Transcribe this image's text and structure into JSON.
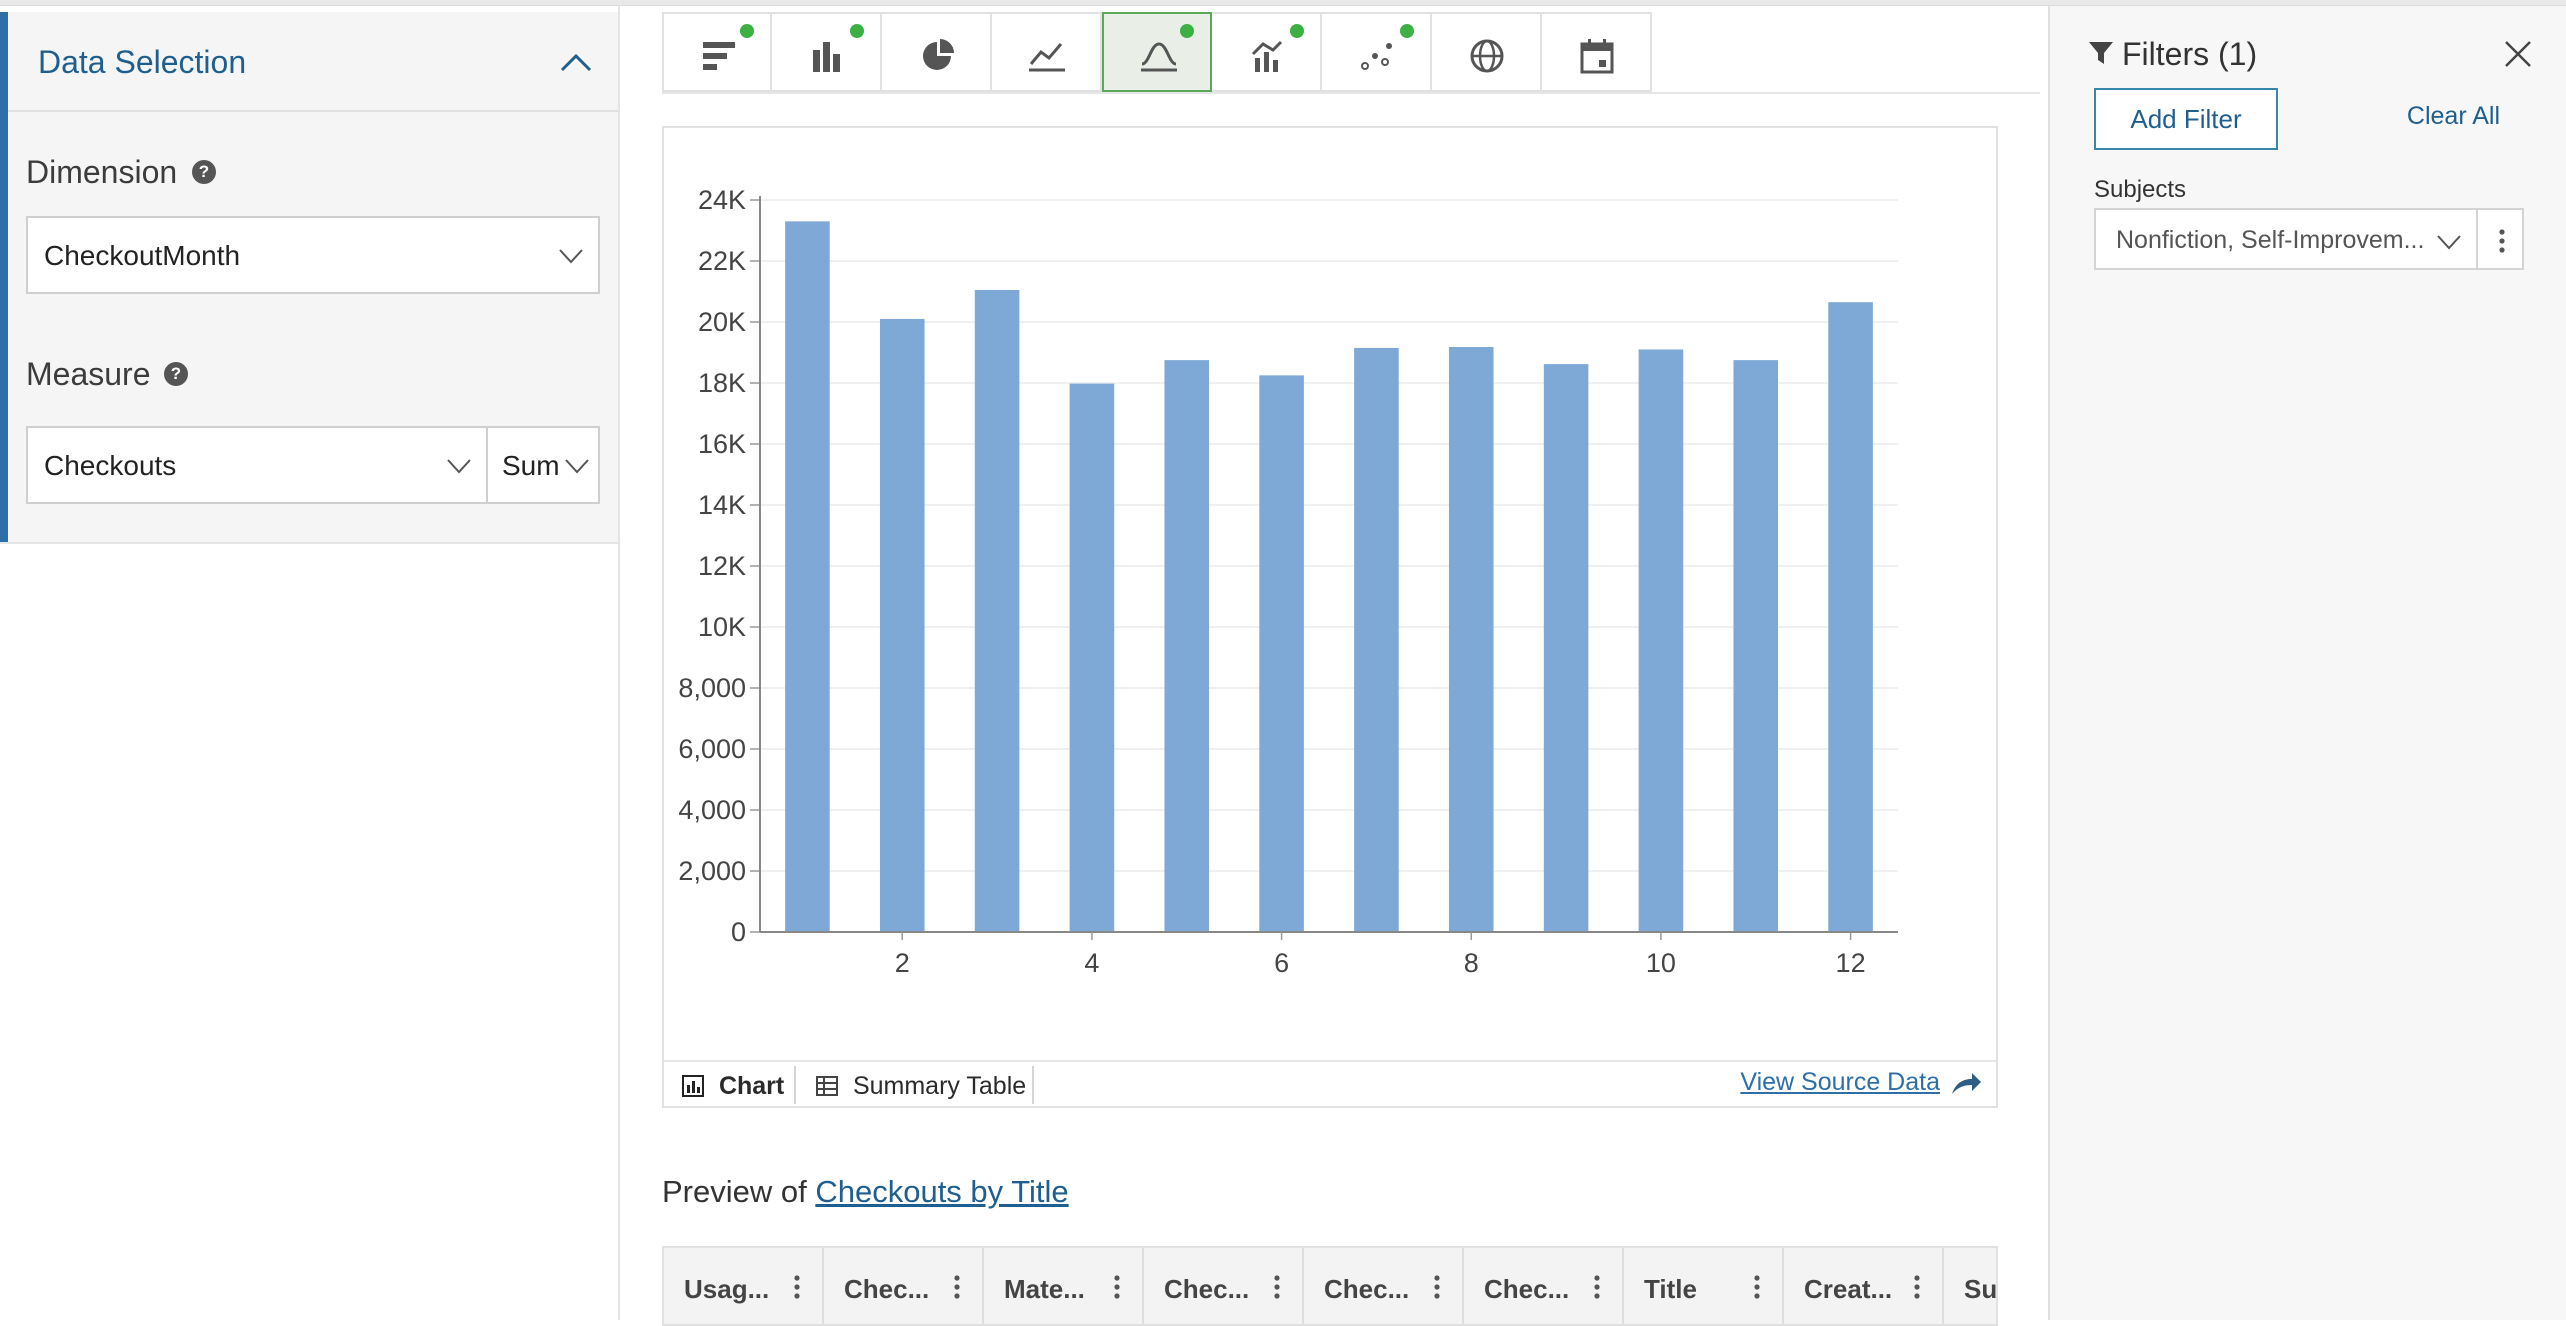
{
  "data_selection": {
    "title": "Data Selection",
    "dimension_label": "Dimension",
    "dimension_value": "CheckoutMonth",
    "measure_label": "Measure",
    "measure_value": "Checkouts",
    "aggregation_value": "Sum"
  },
  "toolbar": {
    "buttons": [
      {
        "icon": "horizontal-bar-chart-icon",
        "has_dot": true,
        "active": false
      },
      {
        "icon": "column-chart-icon",
        "has_dot": true,
        "active": false
      },
      {
        "icon": "pie-chart-icon",
        "has_dot": false,
        "active": false
      },
      {
        "icon": "line-chart-icon",
        "has_dot": false,
        "active": false
      },
      {
        "icon": "distribution-chart-icon",
        "has_dot": true,
        "active": true
      },
      {
        "icon": "combo-chart-icon",
        "has_dot": true,
        "active": false
      },
      {
        "icon": "scatter-chart-icon",
        "has_dot": true,
        "active": false
      },
      {
        "icon": "globe-map-icon",
        "has_dot": false,
        "active": false
      },
      {
        "icon": "calendar-icon",
        "has_dot": false,
        "active": false
      }
    ],
    "dot_color": "#3cb043",
    "active_bg": "#e9efe7"
  },
  "chart_data": {
    "type": "bar",
    "x": [
      1,
      2,
      3,
      4,
      5,
      6,
      7,
      8,
      9,
      10,
      11,
      12
    ],
    "values": [
      23300,
      20100,
      21050,
      17980,
      18750,
      18250,
      19150,
      19180,
      18620,
      19100,
      18750,
      20650
    ],
    "y_ticks": [
      "0",
      "2,000",
      "4,000",
      "6,000",
      "8,000",
      "10K",
      "12K",
      "14K",
      "16K",
      "18K",
      "20K",
      "22K",
      "24K"
    ],
    "x_tick_labels": [
      "2",
      "4",
      "6",
      "8",
      "10",
      "12"
    ],
    "ylim": [
      0,
      24000
    ],
    "xlim": [
      0.5,
      12.5
    ],
    "grid": true,
    "bar_color": "#7ea9d6",
    "title": "",
    "xlabel": "",
    "ylabel": ""
  },
  "chart_footer": {
    "chart_tab": "Chart",
    "summary_tab": "Summary Table",
    "view_source": "View Source Data"
  },
  "preview": {
    "prefix": "Preview of ",
    "link": "Checkouts by Title",
    "columns": [
      "Usag...",
      "Chec...",
      "Mate...",
      "Chec...",
      "Chec...",
      "Chec...",
      "Title",
      "Creat...",
      "Su"
    ]
  },
  "filters": {
    "title": "Filters (1)",
    "add_filter": "Add Filter",
    "clear_all": "Clear All",
    "subjects_label": "Subjects",
    "subjects_value": "Nonfiction, Self-Improvem..."
  },
  "colors": {
    "accent": "#2d6fa6",
    "link": "#1f5f8f"
  }
}
